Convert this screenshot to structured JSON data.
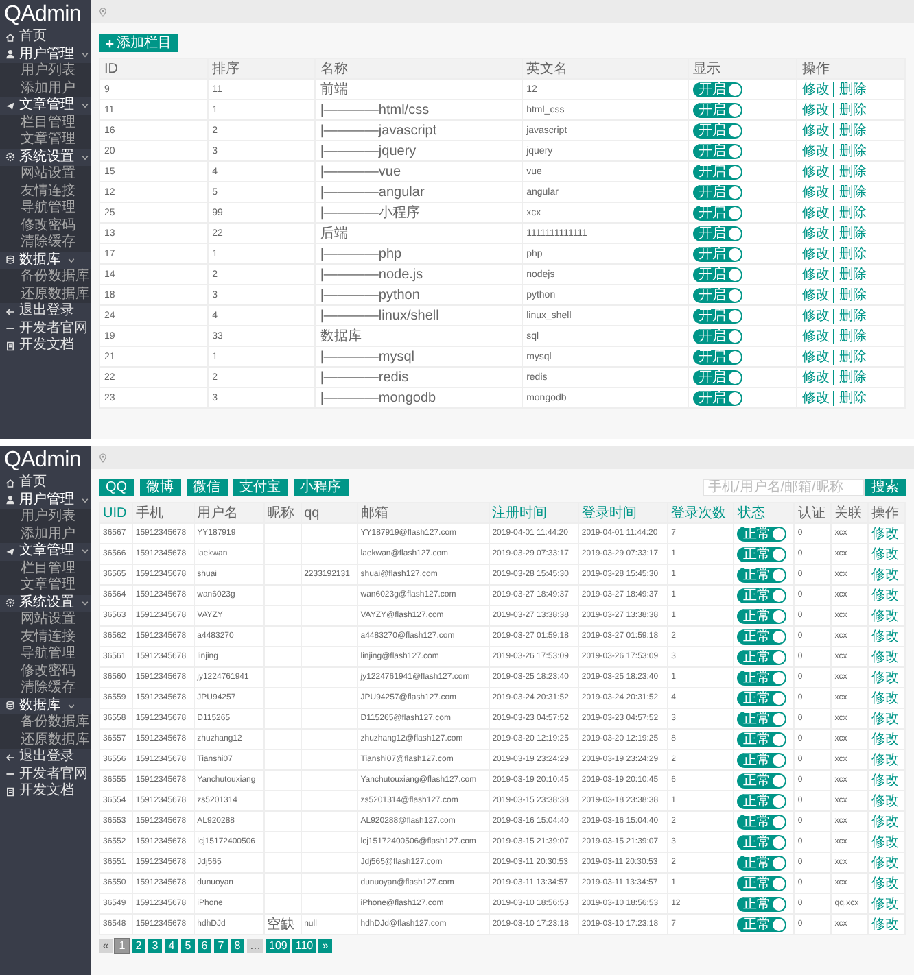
{
  "panels": [
    {
      "kind": "category_list",
      "logo": "QAdmin",
      "sidebar": [
        {
          "label": "首页"
        },
        {
          "label": "用户管理",
          "expanded": true,
          "children": [
            {
              "label": "用户列表"
            },
            {
              "label": "添加用户"
            }
          ]
        },
        {
          "label": "文章管理",
          "expanded": true,
          "children": [
            {
              "label": "栏目管理"
            },
            {
              "label": "文章管理"
            }
          ]
        },
        {
          "label": "系统设置",
          "expanded": true,
          "children": [
            {
              "label": "网站设置"
            },
            {
              "label": "友情连接"
            },
            {
              "label": "导航管理"
            },
            {
              "label": "修改密码"
            },
            {
              "label": "清除缓存"
            }
          ]
        },
        {
          "label": "数据库",
          "expanded": true,
          "children": [
            {
              "label": "备份数据库"
            },
            {
              "label": "还原数据库"
            }
          ]
        },
        {
          "label": "退出登录"
        },
        {
          "label": "开发者官网"
        },
        {
          "label": "开发文档"
        }
      ],
      "add_button": "添加栏目",
      "table": {
        "columns": [
          "ID",
          "排序",
          "名称",
          "英文名",
          "显示",
          "操作"
        ],
        "rows": [
          {
            "id": "9",
            "sort": "11",
            "name": "前端",
            "en_name": "12",
            "visible": {
              "label": "开启",
              "on": true
            },
            "actions": [
              "修改",
              "删除"
            ]
          },
          {
            "id": "11",
            "sort": "1",
            "name": "|————html/css",
            "en_name": "html_css",
            "visible": {
              "label": "开启",
              "on": true
            },
            "actions": [
              "修改",
              "删除"
            ]
          },
          {
            "id": "16",
            "sort": "2",
            "name": "|————javascript",
            "en_name": "javascript",
            "visible": {
              "label": "开启",
              "on": true
            },
            "actions": [
              "修改",
              "删除"
            ]
          },
          {
            "id": "20",
            "sort": "3",
            "name": "|————jquery",
            "en_name": "jquery",
            "visible": {
              "label": "开启",
              "on": true
            },
            "actions": [
              "修改",
              "删除"
            ]
          },
          {
            "id": "15",
            "sort": "4",
            "name": "|————vue",
            "en_name": "vue",
            "visible": {
              "label": "开启",
              "on": true
            },
            "actions": [
              "修改",
              "删除"
            ]
          },
          {
            "id": "12",
            "sort": "5",
            "name": "|————angular",
            "en_name": "angular",
            "visible": {
              "label": "开启",
              "on": true
            },
            "actions": [
              "修改",
              "删除"
            ]
          },
          {
            "id": "25",
            "sort": "99",
            "name": "|————小程序",
            "en_name": "xcx",
            "visible": {
              "label": "开启",
              "on": true
            },
            "actions": [
              "修改",
              "删除"
            ]
          },
          {
            "id": "13",
            "sort": "22",
            "name": "后端",
            "en_name": "1111111111111",
            "visible": {
              "label": "开启",
              "on": true
            },
            "actions": [
              "修改",
              "删除"
            ]
          },
          {
            "id": "17",
            "sort": "1",
            "name": "|————php",
            "en_name": "php",
            "visible": {
              "label": "开启",
              "on": true
            },
            "actions": [
              "修改",
              "删除"
            ]
          },
          {
            "id": "14",
            "sort": "2",
            "name": "|————node.js",
            "en_name": "nodejs",
            "visible": {
              "label": "开启",
              "on": true
            },
            "actions": [
              "修改",
              "删除"
            ]
          },
          {
            "id": "18",
            "sort": "3",
            "name": "|————python",
            "en_name": "python",
            "visible": {
              "label": "开启",
              "on": true
            },
            "actions": [
              "修改",
              "删除"
            ]
          },
          {
            "id": "24",
            "sort": "4",
            "name": "|————linux/shell",
            "en_name": "linux_shell",
            "visible": {
              "label": "开启",
              "on": true
            },
            "actions": [
              "修改",
              "删除"
            ]
          },
          {
            "id": "19",
            "sort": "33",
            "name": "数据库",
            "en_name": "sql",
            "visible": {
              "label": "开启",
              "on": true
            },
            "actions": [
              "修改",
              "删除"
            ]
          },
          {
            "id": "21",
            "sort": "1",
            "name": "|————mysql",
            "en_name": "mysql",
            "visible": {
              "label": "开启",
              "on": true
            },
            "actions": [
              "修改",
              "删除"
            ]
          },
          {
            "id": "22",
            "sort": "2",
            "name": "|————redis",
            "en_name": "redis",
            "visible": {
              "label": "开启",
              "on": true
            },
            "actions": [
              "修改",
              "删除"
            ]
          },
          {
            "id": "23",
            "sort": "3",
            "name": "|————mongodb",
            "en_name": "mongodb",
            "visible": {
              "label": "开启",
              "on": true
            },
            "actions": [
              "修改",
              "删除"
            ]
          }
        ]
      }
    },
    {
      "kind": "user_list",
      "logo": "QAdmin",
      "sidebar": [
        {
          "label": "首页"
        },
        {
          "label": "用户管理",
          "expanded": true,
          "children": [
            {
              "label": "用户列表"
            },
            {
              "label": "添加用户"
            }
          ]
        },
        {
          "label": "文章管理",
          "expanded": true,
          "children": [
            {
              "label": "栏目管理"
            },
            {
              "label": "文章管理"
            }
          ]
        },
        {
          "label": "系统设置",
          "expanded": true,
          "children": [
            {
              "label": "网站设置"
            },
            {
              "label": "友情连接"
            },
            {
              "label": "导航管理"
            },
            {
              "label": "修改密码"
            },
            {
              "label": "清除缓存"
            }
          ]
        },
        {
          "label": "数据库",
          "expanded": true,
          "children": [
            {
              "label": "备份数据库"
            },
            {
              "label": "还原数据库"
            }
          ]
        },
        {
          "label": "退出登录"
        },
        {
          "label": "开发者官网"
        },
        {
          "label": "开发文档"
        }
      ],
      "filter_buttons": [
        "QQ",
        "微博",
        "微信",
        "支付宝",
        "小程序"
      ],
      "search": {
        "placeholder": "手机/用户名/邮箱/昵称",
        "button": "搜索"
      },
      "table": {
        "columns": [
          {
            "label": "UID",
            "sortable": true
          },
          {
            "label": "手机",
            "sortable": false
          },
          {
            "label": "用户名",
            "sortable": false
          },
          {
            "label": "昵称",
            "sortable": false
          },
          {
            "label": "qq",
            "sortable": false
          },
          {
            "label": "邮箱",
            "sortable": false
          },
          {
            "label": "注册时间",
            "sortable": true
          },
          {
            "label": "登录时间",
            "sortable": true
          },
          {
            "label": "登录次数",
            "sortable": true
          },
          {
            "label": "状态",
            "sortable": true
          },
          {
            "label": "认证",
            "sortable": false
          },
          {
            "label": "关联",
            "sortable": false
          },
          {
            "label": "操作",
            "sortable": false
          }
        ],
        "rows": [
          {
            "uid": "36567",
            "phone": "15912345678",
            "username": "YY187919",
            "email": "YY187919@flash127.com",
            "registered": "2019-04-01 11:44:20",
            "last_login": "2019-04-01 11:44:20",
            "logins": "7",
            "status": {
              "label": "正常",
              "on": true
            },
            "verified": "0",
            "linked": "xcx",
            "action": "修改"
          },
          {
            "uid": "36566",
            "phone": "15912345678",
            "username": "laekwan",
            "email": "laekwan@flash127.com",
            "registered": "2019-03-29 07:33:17",
            "last_login": "2019-03-29 07:33:17",
            "logins": "1",
            "status": {
              "label": "正常",
              "on": true
            },
            "verified": "0",
            "linked": "xcx",
            "action": "修改"
          },
          {
            "uid": "36565",
            "phone": "15912345678",
            "username": "shuai",
            "qq": "2233192131",
            "email": "shuai@flash127.com",
            "registered": "2019-03-28 15:45:30",
            "last_login": "2019-03-28 15:45:30",
            "logins": "1",
            "status": {
              "label": "正常",
              "on": true
            },
            "verified": "0",
            "linked": "xcx",
            "action": "修改"
          },
          {
            "uid": "36564",
            "phone": "15912345678",
            "username": "wan6023g",
            "email": "wan6023g@flash127.com",
            "registered": "2019-03-27 18:49:37",
            "last_login": "2019-03-27 18:49:37",
            "logins": "1",
            "status": {
              "label": "正常",
              "on": true
            },
            "verified": "0",
            "linked": "xcx",
            "action": "修改"
          },
          {
            "uid": "36563",
            "phone": "15912345678",
            "username": "VAYZY",
            "email": "VAYZY@flash127.com",
            "registered": "2019-03-27 13:38:38",
            "last_login": "2019-03-27 13:38:38",
            "logins": "1",
            "status": {
              "label": "正常",
              "on": true
            },
            "verified": "0",
            "linked": "xcx",
            "action": "修改"
          },
          {
            "uid": "36562",
            "phone": "15912345678",
            "username": "a4483270",
            "email": "a4483270@flash127.com",
            "registered": "2019-03-27 01:59:18",
            "last_login": "2019-03-27 01:59:18",
            "logins": "2",
            "status": {
              "label": "正常",
              "on": true
            },
            "verified": "0",
            "linked": "xcx",
            "action": "修改"
          },
          {
            "uid": "36561",
            "phone": "15912345678",
            "username": "linjing",
            "email": "linjing@flash127.com",
            "registered": "2019-03-26 17:53:09",
            "last_login": "2019-03-26 17:53:09",
            "logins": "3",
            "status": {
              "label": "正常",
              "on": true
            },
            "verified": "0",
            "linked": "xcx",
            "action": "修改"
          },
          {
            "uid": "36560",
            "phone": "15912345678",
            "username": "jy1224761941",
            "email": "jy1224761941@flash127.com",
            "registered": "2019-03-25 18:23:40",
            "last_login": "2019-03-25 18:23:40",
            "logins": "1",
            "status": {
              "label": "正常",
              "on": true
            },
            "verified": "0",
            "linked": "xcx",
            "action": "修改"
          },
          {
            "uid": "36559",
            "phone": "15912345678",
            "username": "JPU94257",
            "email": "JPU94257@flash127.com",
            "registered": "2019-03-24 20:31:52",
            "last_login": "2019-03-24 20:31:52",
            "logins": "4",
            "status": {
              "label": "正常",
              "on": true
            },
            "verified": "0",
            "linked": "xcx",
            "action": "修改"
          },
          {
            "uid": "36558",
            "phone": "15912345678",
            "username": "D115265",
            "email": "D115265@flash127.com",
            "registered": "2019-03-23 04:57:52",
            "last_login": "2019-03-23 04:57:52",
            "logins": "3",
            "status": {
              "label": "正常",
              "on": true
            },
            "verified": "0",
            "linked": "xcx",
            "action": "修改"
          },
          {
            "uid": "36557",
            "phone": "15912345678",
            "username": "zhuzhang12",
            "email": "zhuzhang12@flash127.com",
            "registered": "2019-03-20 12:19:25",
            "last_login": "2019-03-20 12:19:25",
            "logins": "8",
            "status": {
              "label": "正常",
              "on": true
            },
            "verified": "0",
            "linked": "xcx",
            "action": "修改"
          },
          {
            "uid": "36556",
            "phone": "15912345678",
            "username": "Tianshi07",
            "email": "Tianshi07@flash127.com",
            "registered": "2019-03-19 23:24:29",
            "last_login": "2019-03-19 23:24:29",
            "logins": "2",
            "status": {
              "label": "正常",
              "on": true
            },
            "verified": "0",
            "linked": "xcx",
            "action": "修改"
          },
          {
            "uid": "36555",
            "phone": "15912345678",
            "username": "Yanchutouxiang",
            "email": "Yanchutouxiang@flash127.com",
            "registered": "2019-03-19 20:10:45",
            "last_login": "2019-03-19 20:10:45",
            "logins": "6",
            "status": {
              "label": "正常",
              "on": true
            },
            "verified": "0",
            "linked": "xcx",
            "action": "修改"
          },
          {
            "uid": "36554",
            "phone": "15912345678",
            "username": "zs5201314",
            "email": "zs5201314@flash127.com",
            "registered": "2019-03-15 23:38:38",
            "last_login": "2019-03-18 23:38:38",
            "logins": "1",
            "status": {
              "label": "正常",
              "on": true
            },
            "verified": "0",
            "linked": "xcx",
            "action": "修改"
          },
          {
            "uid": "36553",
            "phone": "15912345678",
            "username": "AL920288",
            "email": "AL920288@flash127.com",
            "registered": "2019-03-16 15:04:40",
            "last_login": "2019-03-16 15:04:40",
            "logins": "2",
            "status": {
              "label": "正常",
              "on": true
            },
            "verified": "0",
            "linked": "xcx",
            "action": "修改"
          },
          {
            "uid": "36552",
            "phone": "15912345678",
            "username": "lcj15172400506",
            "email": "lcj15172400506@flash127.com",
            "registered": "2019-03-15 21:39:07",
            "last_login": "2019-03-15 21:39:07",
            "logins": "3",
            "status": {
              "label": "正常",
              "on": true
            },
            "verified": "0",
            "linked": "xcx",
            "action": "修改"
          },
          {
            "uid": "36551",
            "phone": "15912345678",
            "username": "Jdj565",
            "email": "Jdj565@flash127.com",
            "registered": "2019-03-11 20:30:53",
            "last_login": "2019-03-11 20:30:53",
            "logins": "2",
            "status": {
              "label": "正常",
              "on": true
            },
            "verified": "0",
            "linked": "xcx",
            "action": "修改"
          },
          {
            "uid": "36550",
            "phone": "15912345678",
            "username": "dunuoyan",
            "email": "dunuoyan@flash127.com",
            "registered": "2019-03-11 13:34:57",
            "last_login": "2019-03-11 13:34:57",
            "logins": "1",
            "status": {
              "label": "正常",
              "on": true
            },
            "verified": "0",
            "linked": "xcx",
            "action": "修改"
          },
          {
            "uid": "36549",
            "phone": "15912345678",
            "username": "iPhone",
            "email": "iPhone@flash127.com",
            "registered": "2019-03-10 18:56:53",
            "last_login": "2019-03-10 18:56:53",
            "logins": "12",
            "status": {
              "label": "正常",
              "on": true
            },
            "verified": "0",
            "linked": "qq,xcx",
            "action": "修改"
          },
          {
            "uid": "36548",
            "phone": "15912345678",
            "username": "hdhDJd",
            "nickname": "空缺",
            "qq": "null",
            "email": "hdhDJd@flash127.com",
            "registered": "2019-03-10 17:23:18",
            "last_login": "2019-03-10 17:23:18",
            "logins": "7",
            "status": {
              "label": "正常",
              "on": true
            },
            "verified": "0",
            "linked": "xcx",
            "action": "修改"
          }
        ]
      },
      "pagination": [
        {
          "label": "«",
          "selected": false,
          "disabled": true
        },
        {
          "label": "1",
          "selected": true,
          "disabled": false
        },
        {
          "label": "2",
          "selected": false,
          "disabled": false
        },
        {
          "label": "3",
          "selected": false,
          "disabled": false
        },
        {
          "label": "4",
          "selected": false,
          "disabled": false
        },
        {
          "label": "5",
          "selected": false,
          "disabled": false
        },
        {
          "label": "6",
          "selected": false,
          "disabled": false
        },
        {
          "label": "7",
          "selected": false,
          "disabled": false
        },
        {
          "label": "8",
          "selected": false,
          "disabled": false
        },
        {
          "label": "…",
          "selected": false,
          "disabled": true
        },
        {
          "label": "109",
          "selected": false,
          "disabled": false
        },
        {
          "label": "110",
          "selected": false,
          "disabled": false
        },
        {
          "label": "»",
          "selected": false,
          "disabled": false
        }
      ]
    }
  ]
}
